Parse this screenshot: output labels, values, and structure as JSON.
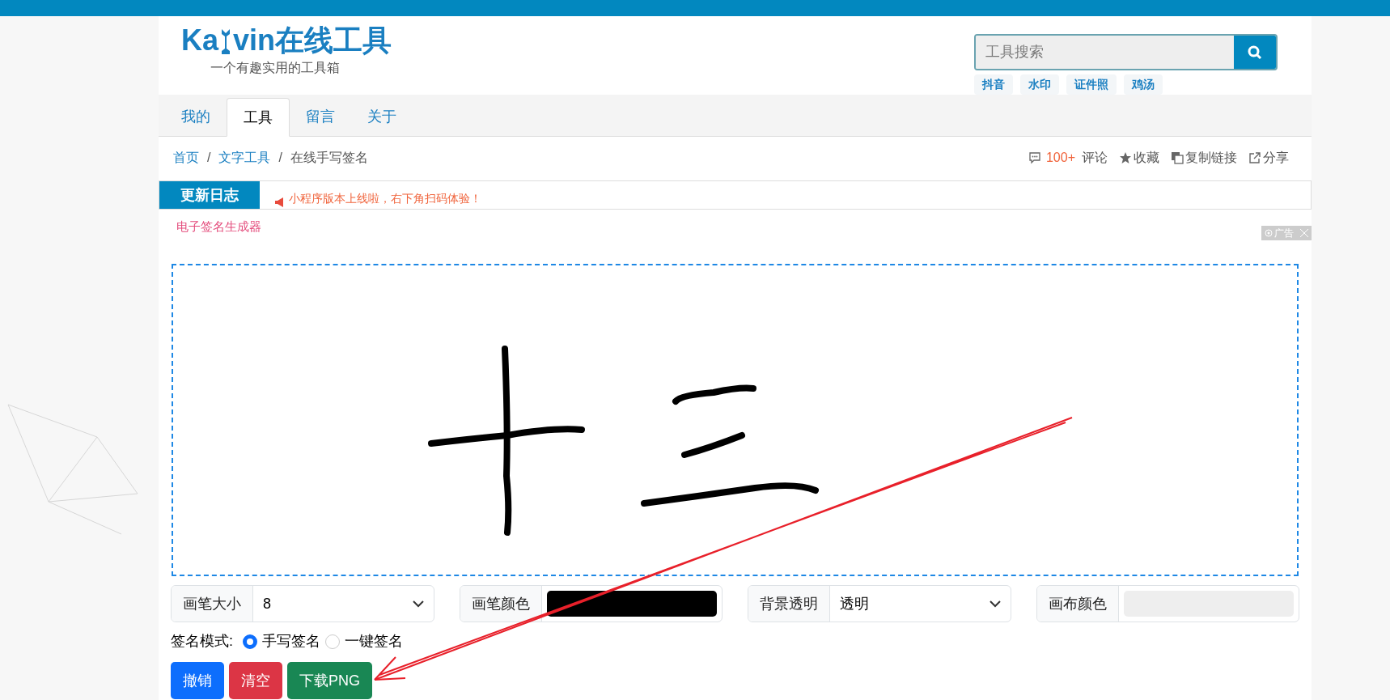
{
  "header": {
    "logo_parts": [
      "Ka",
      "vin在线工具"
    ],
    "tagline": "一个有趣实用的工具箱",
    "search": {
      "placeholder": "工具搜索"
    },
    "hot_tags": [
      "抖音",
      "水印",
      "证件照",
      "鸡汤"
    ]
  },
  "nav": [
    {
      "label": "我的",
      "selected": false
    },
    {
      "label": "工具",
      "selected": true
    },
    {
      "label": "留言",
      "selected": false
    },
    {
      "label": "关于",
      "selected": false
    }
  ],
  "breadcrumb": [
    {
      "kind": "link",
      "label": "首页"
    },
    {
      "kind": "separator",
      "label": "/"
    },
    {
      "kind": "link",
      "label": "文字工具"
    },
    {
      "kind": "separator",
      "label": "/"
    },
    {
      "kind": "current",
      "label": "在线手写签名"
    }
  ],
  "actions": [
    {
      "kind": "comment",
      "count": "100+",
      "label": "评论"
    },
    {
      "kind": "star",
      "label": "收藏"
    },
    {
      "kind": "copy",
      "label": "复制链接"
    },
    {
      "kind": "share",
      "label": "分享"
    }
  ],
  "notice": {
    "title": "更新日志",
    "message": "小程序版本上线啦，右下角扫码体验！"
  },
  "tool_title": "电子签名生成器",
  "ad_label": "广告",
  "controls": [
    {
      "kind": "select",
      "label": "画笔大小",
      "value": "8"
    },
    {
      "kind": "color",
      "label": "画笔颜色",
      "color": "#000000"
    },
    {
      "kind": "select",
      "label": "背景透明",
      "value": "透明"
    },
    {
      "kind": "color",
      "label": "画布颜色",
      "color": "#eeeeee"
    }
  ],
  "mode": {
    "label": "签名模式:",
    "options": [
      {
        "label": "手写签名",
        "selected": true
      },
      {
        "label": "一键签名",
        "selected": false
      }
    ]
  },
  "buttons": [
    {
      "label": "撤销",
      "color": "#0d6efd"
    },
    {
      "label": "清空",
      "color": "#dc3545"
    },
    {
      "label": "下载PNG",
      "color": "#198754"
    }
  ]
}
